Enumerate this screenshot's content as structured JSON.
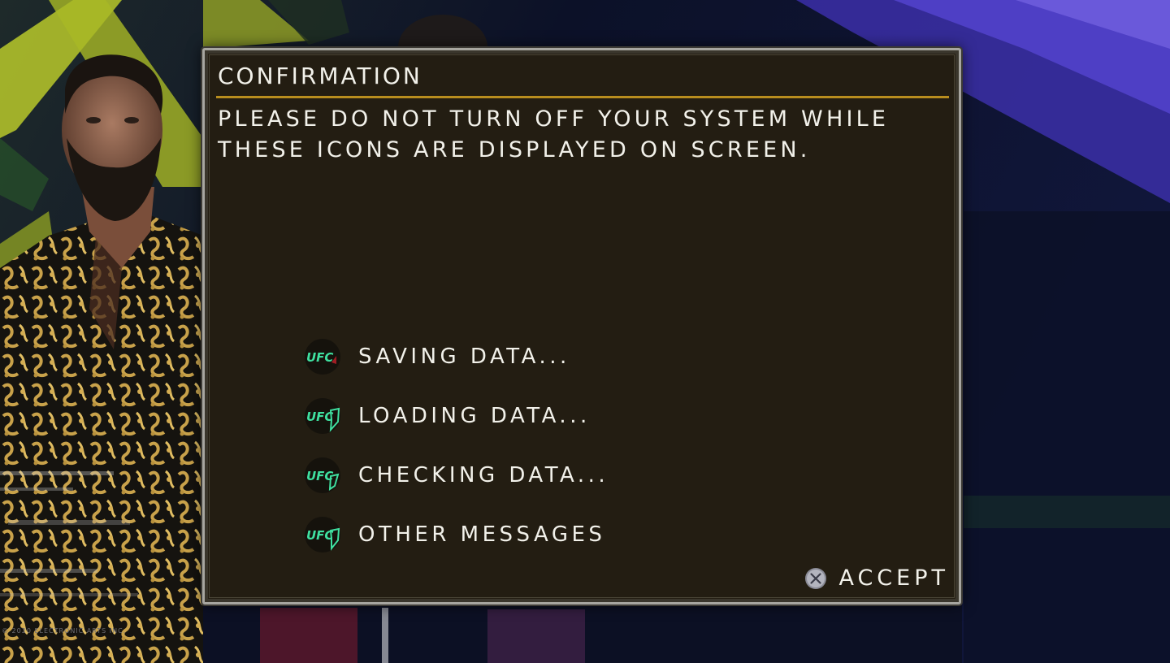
{
  "dialog": {
    "title": "CONFIRMATION",
    "message_line_1": "PLEASE DO NOT TURN OFF YOUR SYSTEM WHILE",
    "message_line_2": "THESE ICONS ARE DISPLAYED ON SCREEN.",
    "icon_rows": [
      {
        "icon": "ufc-saving-icon",
        "label": "SAVING DATA..."
      },
      {
        "icon": "ufc-loading-icon",
        "label": "LOADING DATA..."
      },
      {
        "icon": "ufc-checking-icon",
        "label": "CHECKING DATA..."
      },
      {
        "icon": "ufc-other-icon",
        "label": "OTHER MESSAGES"
      }
    ],
    "accept": {
      "icon": "cross-button-icon",
      "label": "ACCEPT"
    }
  },
  "background": {
    "copyright": "© 2020 ELECTRONIC ARTS INC."
  },
  "colors": {
    "dialog_bg": "#231d12",
    "title_rule": "#b88d1e",
    "ufc_green": "#3fe0a0",
    "text": "#f2f1ea"
  }
}
